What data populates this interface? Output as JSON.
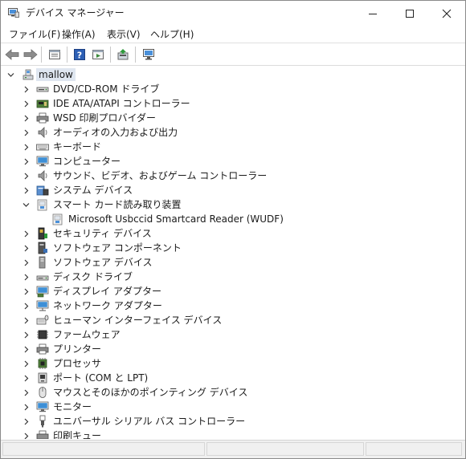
{
  "window": {
    "title": "デバイス マネージャー",
    "minimize_icon": "minimize-icon",
    "maximize_icon": "maximize-icon",
    "close_icon": "close-icon"
  },
  "menu": [
    {
      "label": "ファイル(F)"
    },
    {
      "label": "操作(A)"
    },
    {
      "label": "表示(V)"
    },
    {
      "label": "ヘルプ(H)"
    }
  ],
  "toolbar": {
    "buttons": [
      "back-arrow-icon",
      "forward-arrow-icon",
      "properties-icon",
      "help-icon",
      "run-icon",
      "update-driver-icon",
      "scan-hardware-icon"
    ]
  },
  "tree": {
    "root": {
      "label": "mallow",
      "icon": "computer-root-icon",
      "expanded": true
    },
    "items": [
      {
        "label": "DVD/CD-ROM ドライブ",
        "icon": "dvd-drive-icon",
        "expanded": false
      },
      {
        "label": "IDE ATA/ATAPI コントローラー",
        "icon": "ide-controller-icon",
        "expanded": false
      },
      {
        "label": "WSD 印刷プロバイダー",
        "icon": "printer-icon",
        "expanded": false
      },
      {
        "label": "オーディオの入力および出力",
        "icon": "speaker-icon",
        "expanded": false
      },
      {
        "label": "キーボード",
        "icon": "keyboard-icon",
        "expanded": false
      },
      {
        "label": "コンピューター",
        "icon": "monitor-icon",
        "expanded": false
      },
      {
        "label": "サウンド、ビデオ、およびゲーム コントローラー",
        "icon": "speaker-icon",
        "expanded": false
      },
      {
        "label": "システム デバイス",
        "icon": "system-devices-icon",
        "expanded": false
      },
      {
        "label": "スマート カード読み取り装置",
        "icon": "smartcard-reader-icon",
        "expanded": true
      },
      {
        "label": "Microsoft Usbccid Smartcard Reader (WUDF)",
        "icon": "smartcard-reader-icon",
        "child": true
      },
      {
        "label": "セキュリティ デバイス",
        "icon": "security-device-icon",
        "expanded": false
      },
      {
        "label": "ソフトウェア コンポーネント",
        "icon": "software-component-icon",
        "expanded": false
      },
      {
        "label": "ソフトウェア デバイス",
        "icon": "software-device-icon",
        "expanded": false
      },
      {
        "label": "ディスク ドライブ",
        "icon": "disk-drive-icon",
        "expanded": false
      },
      {
        "label": "ディスプレイ アダプター",
        "icon": "display-adapter-icon",
        "expanded": false
      },
      {
        "label": "ネットワーク アダプター",
        "icon": "network-adapter-icon",
        "expanded": false
      },
      {
        "label": "ヒューマン インターフェイス デバイス",
        "icon": "hid-icon",
        "expanded": false
      },
      {
        "label": "ファームウェア",
        "icon": "firmware-icon",
        "expanded": false
      },
      {
        "label": "プリンター",
        "icon": "printer-icon",
        "expanded": false
      },
      {
        "label": "プロセッサ",
        "icon": "processor-icon",
        "expanded": false
      },
      {
        "label": "ポート (COM と LPT)",
        "icon": "port-icon",
        "expanded": false
      },
      {
        "label": "マウスとそのほかのポインティング デバイス",
        "icon": "mouse-icon",
        "expanded": false
      },
      {
        "label": "モニター",
        "icon": "monitor-icon",
        "expanded": false
      },
      {
        "label": "ユニバーサル シリアル バス コントローラー",
        "icon": "usb-icon",
        "expanded": false
      },
      {
        "label": "印刷キュー",
        "icon": "print-queue-icon",
        "expanded": false
      }
    ]
  },
  "colors": {
    "selection": "#dfe6f0",
    "accent": "#1e6fc9"
  }
}
